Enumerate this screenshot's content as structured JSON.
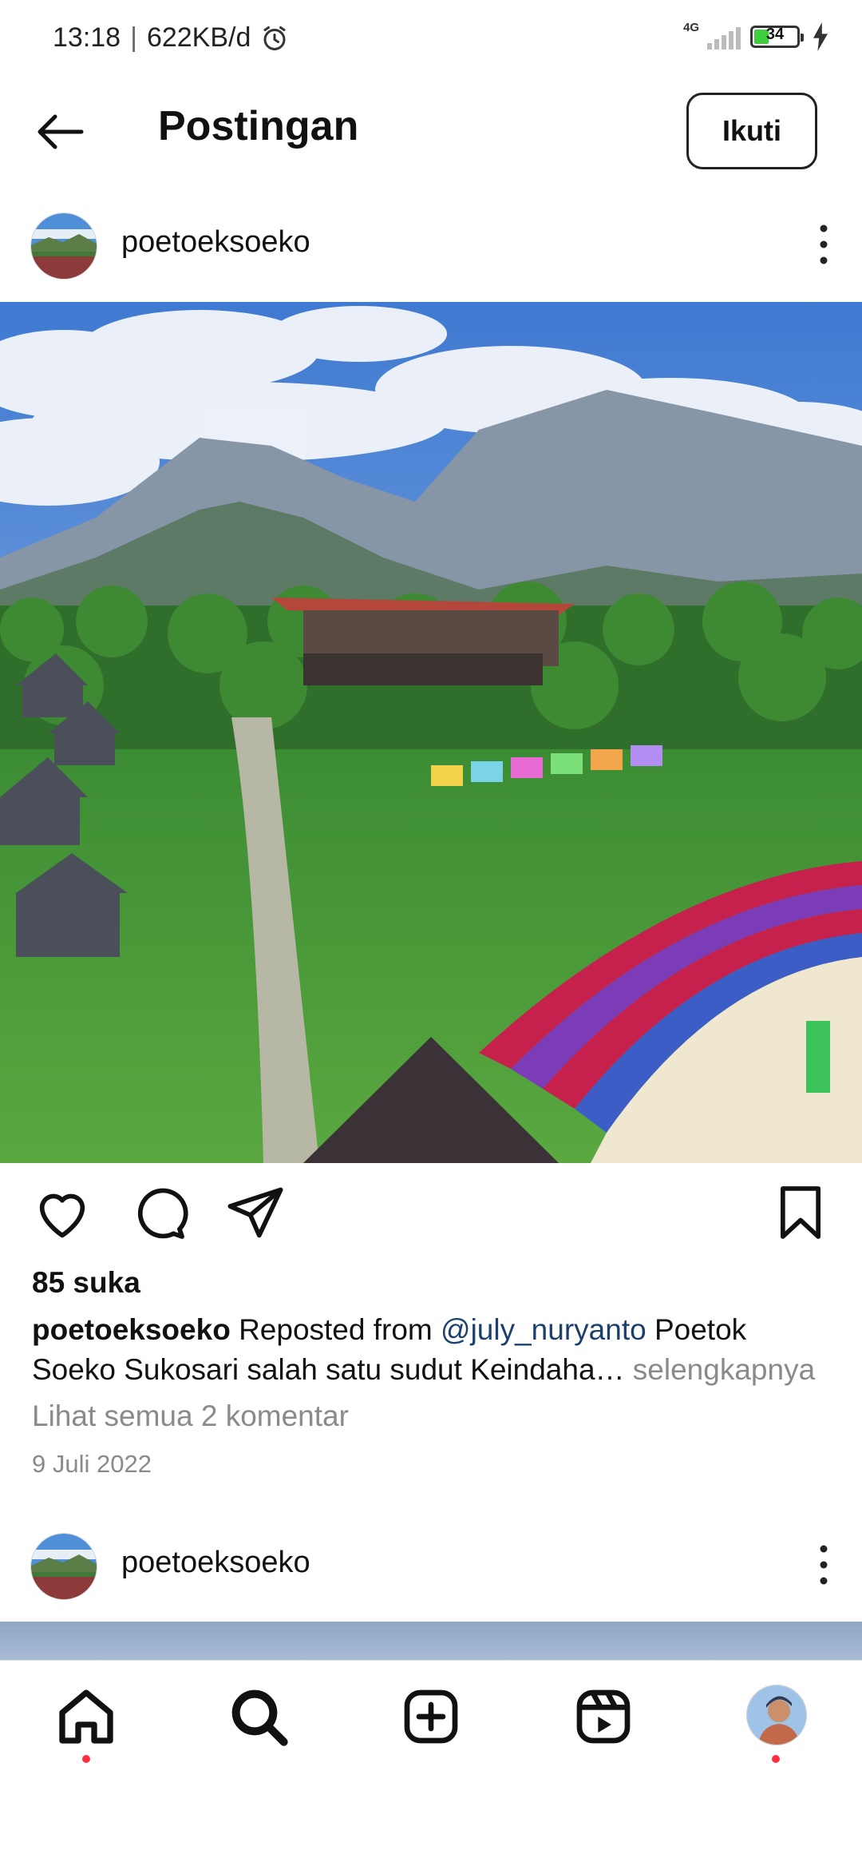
{
  "status_bar": {
    "time": "13:18",
    "net_speed": "622KB/d",
    "network": "4G",
    "battery": "34"
  },
  "app_bar": {
    "title": "Postingan",
    "follow_label": "Ikuti"
  },
  "post": {
    "username": "poetoeksoeko",
    "likes": "85 suka",
    "caption_user": "poetoeksoeko",
    "caption_pre": " Reposted from ",
    "caption_mention": "@july_nuryanto",
    "caption_post": " Poetok Soeko Sukosari salah satu sudut Keindaha…",
    "caption_more": " selengkapnya",
    "comments_link": "Lihat semua 2 komentar",
    "date": "9 Juli 2022"
  },
  "next_post": {
    "username": "poetoeksoeko"
  },
  "nav": {
    "items": [
      "home-icon",
      "search-icon",
      "create-post-icon",
      "reels-icon",
      "profile-avatar"
    ]
  },
  "colors": {
    "notification_dot": "#ff3040",
    "mention": "#1d3f6e",
    "secondary_text": "#8a8a8a"
  }
}
